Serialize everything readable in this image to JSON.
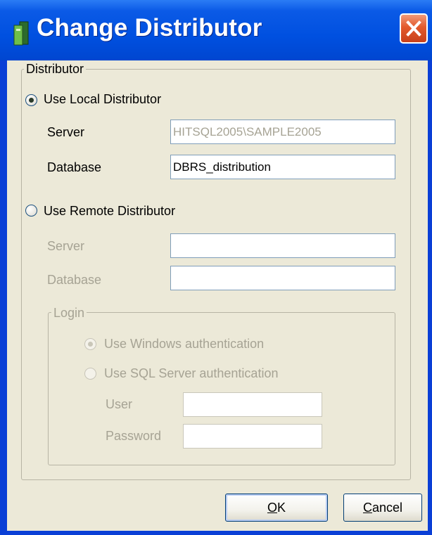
{
  "window": {
    "title": "Change Distributor"
  },
  "distributor_group": {
    "legend": "Distributor",
    "local": {
      "label": "Use Local Distributor",
      "selected": true,
      "server_label": "Server",
      "server_value": "HITSQL2005\\SAMPLE2005",
      "database_label": "Database",
      "database_value": "DBRS_distribution"
    },
    "remote": {
      "label": "Use Remote Distributor",
      "selected": false,
      "server_label": "Server",
      "server_value": "",
      "database_label": "Database",
      "database_value": ""
    },
    "login": {
      "legend": "Login",
      "windows_auth_label": "Use Windows authentication",
      "windows_auth_selected": true,
      "sql_auth_label": "Use SQL Server authentication",
      "sql_auth_selected": false,
      "user_label": "User",
      "user_value": "",
      "password_label": "Password",
      "password_value": ""
    }
  },
  "buttons": {
    "ok_mnemonic": "O",
    "ok_rest": "K",
    "cancel_mnemonic": "C",
    "cancel_rest": "ancel"
  }
}
